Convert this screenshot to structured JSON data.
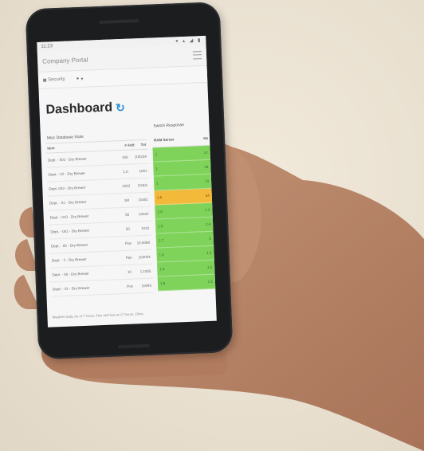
{
  "colors": {
    "green_cell": "#7fd35a",
    "orange_cell": "#f2b93b",
    "accent_blue": "#2a8fd6"
  },
  "status": {
    "time": "11:23",
    "indicators": "▾ ▴ ◢ ▮"
  },
  "appbar": {
    "title": "Company Portal"
  },
  "subbar": {
    "item1": "Security",
    "item2": "▾"
  },
  "dashboard": {
    "title": "Dashboard",
    "refresh_icon": "↻"
  },
  "left_table": {
    "title": "Misc Database Stats",
    "headers": [
      "Item",
      "# Add",
      "Tot"
    ],
    "rows": [
      [
        "Dept. - 001 - Dry Brewer",
        "106",
        "100234"
      ],
      [
        "Dept. - 02 - Dry Brewer",
        "1.0",
        "1001"
      ],
      [
        "Dept. 003 - Dry Brewer",
        "1062",
        "10401"
      ],
      [
        "Dept. - 01 - Dry Brewer",
        "1M",
        "10451"
      ],
      [
        "Dept. - 010 - Dry Brewer",
        "50",
        "10042"
      ],
      [
        "Dept. - 001 - Dry Brewer",
        "50",
        "1010"
      ],
      [
        "Dept. - 00 - Dry Brewer",
        "Pas",
        "10.0089"
      ],
      [
        "Dept. - 2 - Dry Brewer",
        "Pan",
        "102004"
      ],
      [
        "Dept. - 00 - Dry Brewer",
        "10",
        "1.1005"
      ],
      [
        "Dept. - 01 - Dry Brewer",
        "Pos",
        "10045"
      ]
    ]
  },
  "right_table": {
    "title": "Switch Response",
    "headers": [
      "RAM Server",
      "Hs"
    ],
    "cells": [
      [
        "1",
        "12"
      ],
      [
        "1",
        "34"
      ],
      [
        "1",
        "74"
      ],
      [
        "1.8",
        "54"
      ],
      [
        "1.8",
        "7.3"
      ],
      [
        "1.9",
        "2.4"
      ],
      [
        "1.7",
        "5"
      ],
      [
        "1.5",
        "1.5"
      ],
      [
        "1.5",
        "1.5"
      ],
      [
        "1.8",
        "1.5"
      ]
    ],
    "cell_status": [
      "green",
      "green",
      "green",
      "orange",
      "green",
      "green",
      "green",
      "green",
      "green",
      "green"
    ]
  },
  "footer": {
    "note": "Weather Data: As of 7 hours, 2ms and less at 17 hours, 10ms"
  }
}
